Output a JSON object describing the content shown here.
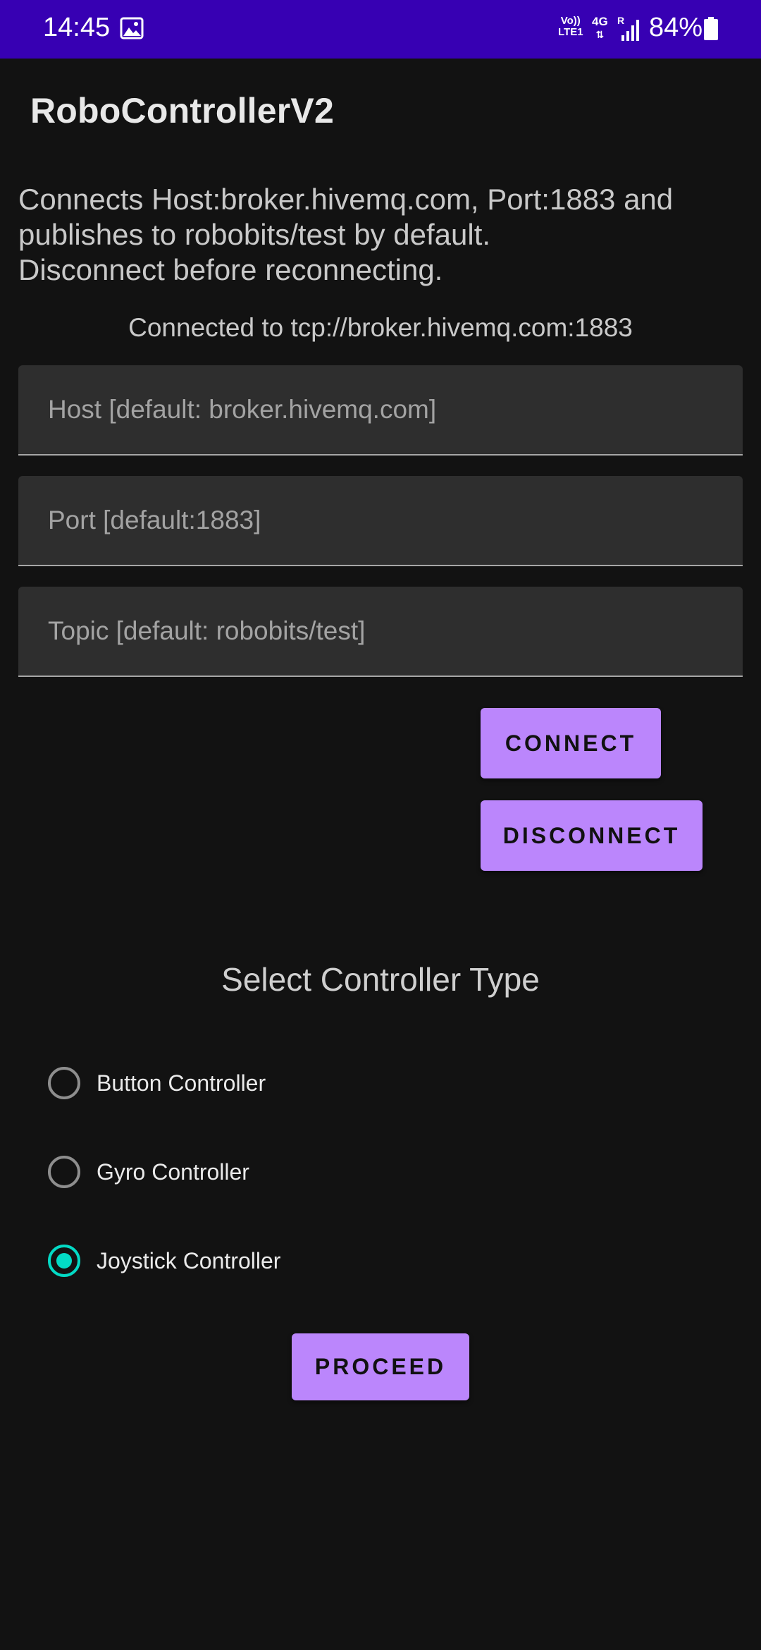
{
  "status_bar": {
    "time": "14:45",
    "network_top": "Vo))",
    "network_bottom": "LTE1",
    "mobile_data": "4G",
    "roaming": "R",
    "battery_percent": "84%"
  },
  "app": {
    "title": "RoboControllerV2"
  },
  "description_lines": [
    "Connects Host:broker.hivemq.com, Port:1883 and",
    "publishes to robobits/test by default.",
    "Disconnect before reconnecting."
  ],
  "connection_status": "Connected to tcp://broker.hivemq.com:1883",
  "fields": {
    "host": {
      "placeholder": "Host [default: broker.hivemq.com]",
      "value": ""
    },
    "port": {
      "placeholder": "Port [default:1883]",
      "value": ""
    },
    "topic": {
      "placeholder": "Topic [default: robobits/test]",
      "value": ""
    }
  },
  "buttons": {
    "connect": "CONNECT",
    "disconnect": "DISCONNECT",
    "proceed": "PROCEED"
  },
  "controller_section": {
    "title": "Select Controller Type",
    "options": [
      {
        "label": "Button Controller",
        "selected": false
      },
      {
        "label": "Gyro Controller",
        "selected": false
      },
      {
        "label": "Joystick Controller",
        "selected": true
      }
    ]
  },
  "colors": {
    "status_bar": "#3700b3",
    "background": "#121212",
    "button": "#bb86fc",
    "radio_selected": "#03dac5"
  }
}
